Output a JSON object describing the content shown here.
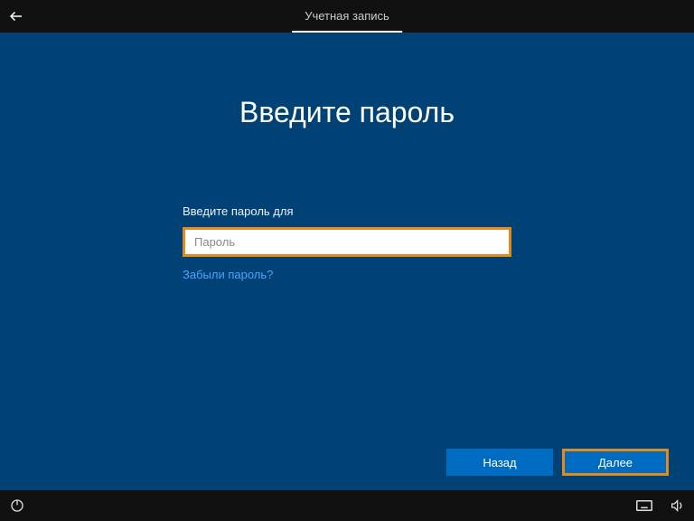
{
  "topbar": {
    "tab_label": "Учетная запись"
  },
  "title": "Введите пароль",
  "form": {
    "prompt": "Введите пароль для",
    "password_placeholder": "Пароль",
    "password_value": "",
    "forgot_label": "Забыли пароль?"
  },
  "buttons": {
    "back_label": "Назад",
    "next_label": "Далее"
  },
  "colors": {
    "background": "#004275",
    "highlight": "#e28a1a",
    "button": "#006cc1",
    "link": "#4aa3ff"
  }
}
